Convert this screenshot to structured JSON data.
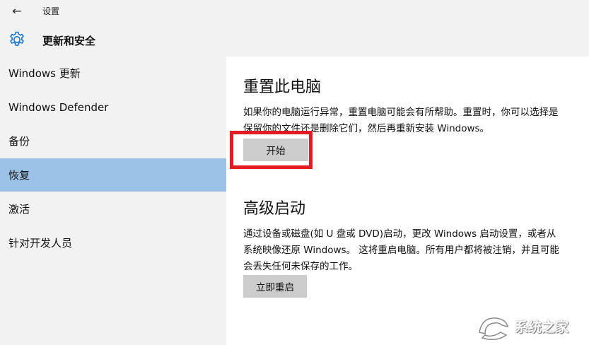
{
  "window": {
    "title": "设置"
  },
  "header": {
    "section_title": "更新和安全",
    "back_icon": "←"
  },
  "sidebar": {
    "items": [
      {
        "label": "Windows 更新",
        "selected": false
      },
      {
        "label": "Windows Defender",
        "selected": false
      },
      {
        "label": "备份",
        "selected": false
      },
      {
        "label": "恢复",
        "selected": true
      },
      {
        "label": "激活",
        "selected": false
      },
      {
        "label": "针对开发人员",
        "selected": false
      }
    ]
  },
  "main": {
    "reset": {
      "heading": "重置此电脑",
      "description": "如果你的电脑运行异常，重置电脑可能会有所帮助。重置时，你可以选择是保留你的文件还是删除它们，然后再重新安装 Windows。",
      "button_label": "开始"
    },
    "advanced": {
      "heading": "高级启动",
      "description": "通过设备或磁盘(如 U 盘或 DVD)启动，更改 Windows 启动设置，或者从系统映像还原 Windows。 这将重启电脑。所有用户都将被注销，并且可能会丢失任何未保存的工作。",
      "button_label": "立即重启"
    }
  },
  "watermark": {
    "text": "系统之家"
  },
  "colors": {
    "chrome_bg": "#f2f2f2",
    "selected_item": "#99c2e6",
    "button_bg": "#cccccc",
    "highlight": "#e21b24"
  }
}
